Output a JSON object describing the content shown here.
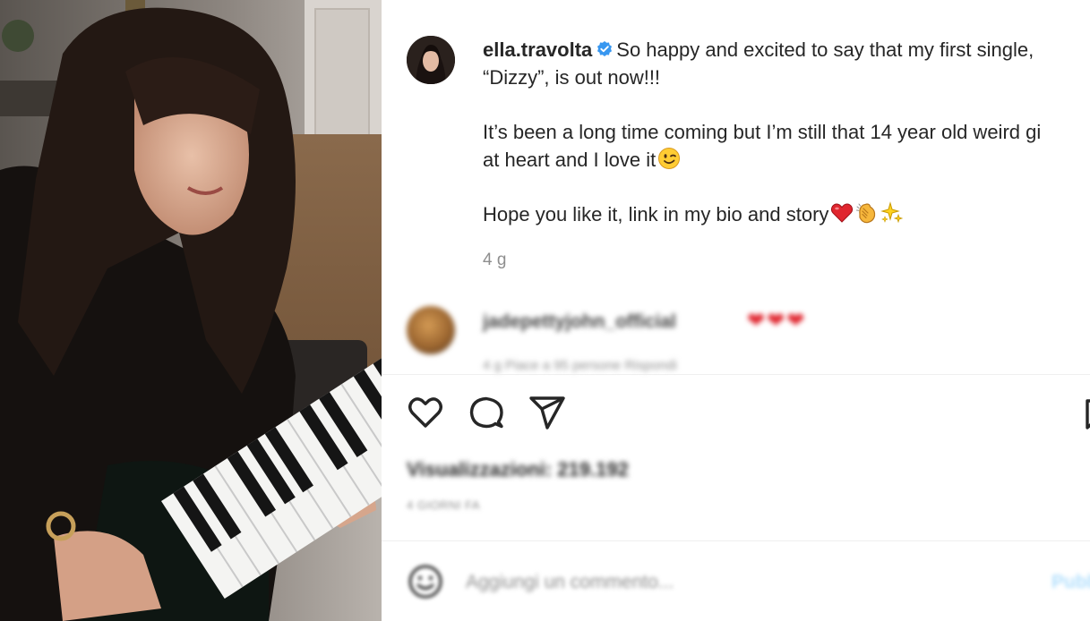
{
  "post": {
    "username": "ella.travolta",
    "caption_line1": "So happy and excited to say that my first single,",
    "caption_line2": "“Dizzy”, is out now!!!",
    "caption_line3": "It’s been a long time coming but I’m still that 14 year old weird gi",
    "caption_line4": "at heart and I love it",
    "caption_line5": "Hope you like it, link in my bio and story",
    "time": "4 g",
    "emojis": [
      "wink-emoji",
      "red-heart-emoji",
      "clapping-hands-emoji",
      "sparkles-emoji"
    ]
  },
  "comment": {
    "username": "jadepettyjohn_official",
    "text": "❤❤❤",
    "meta": "4 g    Piace a 95 persone    Rispondi"
  },
  "stats": {
    "views": "Visualizzazioni: 219.192",
    "date": "4 GIORNI FA"
  },
  "add_comment": {
    "placeholder": "Aggiungi un commento...",
    "publish_label": "Pubblica"
  },
  "icons": {
    "like": "heart-icon",
    "comment": "comment-icon",
    "share": "share-icon",
    "save": "bookmark-icon",
    "emoji": "smiley-icon",
    "verified": "verified-badge-icon"
  },
  "colors": {
    "verified_blue": "#3897f0",
    "text": "#262626",
    "secondary_text": "#8e8e8e",
    "heart_red": "#e0262f",
    "publish_blue": "#b2dffc"
  }
}
